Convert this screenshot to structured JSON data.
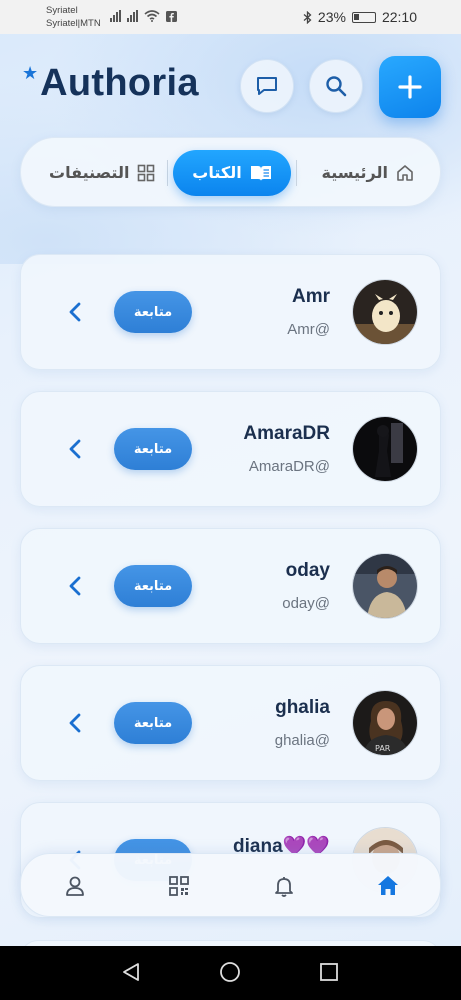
{
  "status_bar": {
    "carrier_line1": "Syriatel",
    "carrier_line2": "Syriatel|MTN",
    "battery": "23%",
    "time": "22:10"
  },
  "header": {
    "logo": "Authoria",
    "icons": [
      "chat-icon",
      "search-icon",
      "plus-icon"
    ]
  },
  "tabs": [
    {
      "label": "التصنيفات",
      "icon": "grid-icon",
      "active": false
    },
    {
      "label": "الكتاب",
      "icon": "book-icon",
      "active": true
    },
    {
      "label": "الرئيسية",
      "icon": "home-icon",
      "active": false
    }
  ],
  "users": [
    {
      "name": "Amr",
      "handle": "Amr@",
      "follow_label": "متابعة"
    },
    {
      "name": "AmaraDR",
      "handle": "AmaraDR@",
      "follow_label": "متابعة"
    },
    {
      "name": "oday",
      "handle": "oday@",
      "follow_label": "متابعة"
    },
    {
      "name": "ghalia",
      "handle": "ghalia@",
      "follow_label": "متابعة"
    },
    {
      "name": "diana💜💜",
      "handle": "",
      "follow_label": "متابعة"
    }
  ],
  "bottom_nav": [
    "profile-icon",
    "grid-icon",
    "bell-icon",
    "home-icon"
  ],
  "colors": {
    "accent": "#0d83ec",
    "logo": "#15325a",
    "follow": "#2e7fd6"
  }
}
